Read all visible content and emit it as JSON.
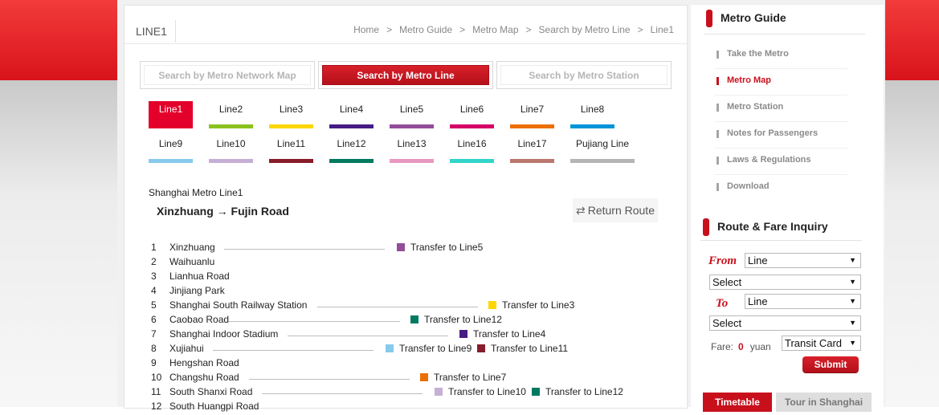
{
  "header": {
    "title": "LINE1",
    "breadcrumbs": [
      "Home",
      "Metro Guide",
      "Metro Map",
      "Search by Metro Line",
      "Line1"
    ],
    "separator": ">"
  },
  "search_tabs": [
    {
      "label": "Search by Metro Network Map",
      "active": false
    },
    {
      "label": "Search by Metro Line",
      "active": true
    },
    {
      "label": "Search by Metro Station",
      "active": false
    }
  ],
  "lines": [
    {
      "label": "Line1",
      "color": "#e3002b",
      "active": true
    },
    {
      "label": "Line2",
      "color": "#8cc220"
    },
    {
      "label": "Line3",
      "color": "#fcd600"
    },
    {
      "label": "Line4",
      "color": "#461d84"
    },
    {
      "label": "Line5",
      "color": "#944d9a"
    },
    {
      "label": "Line6",
      "color": "#d40068"
    },
    {
      "label": "Line7",
      "color": "#ed6f00"
    },
    {
      "label": "Line8",
      "color": "#0094d8"
    },
    {
      "label": "Line9",
      "color": "#87caed"
    },
    {
      "label": "Line10",
      "color": "#c6afd4"
    },
    {
      "label": "Line11",
      "color": "#871c2b"
    },
    {
      "label": "Line12",
      "color": "#007a60"
    },
    {
      "label": "Line13",
      "color": "#e999c0"
    },
    {
      "label": "Line16",
      "color": "#32d4cb"
    },
    {
      "label": "Line17",
      "color": "#bb786e"
    },
    {
      "label": "Pujiang Line",
      "color": "#b5b5b6"
    }
  ],
  "route": {
    "subtitle": "Shanghai Metro Line1",
    "title": "Xinzhuang → Fujin Road",
    "return_label": "Return Route",
    "return_icon": "swap-arrows-icon"
  },
  "stations": [
    {
      "num": "1",
      "name": "Xinzhuang",
      "transfers": [
        {
          "label": "Transfer to Line5",
          "color": "#944d9a"
        }
      ]
    },
    {
      "num": "2",
      "name": "Waihuanlu",
      "transfers": []
    },
    {
      "num": "3",
      "name": "Lianhua Road",
      "transfers": []
    },
    {
      "num": "4",
      "name": "Jinjiang Park",
      "transfers": []
    },
    {
      "num": "5",
      "name": "Shanghai South Railway Station",
      "transfers": [
        {
          "label": "Transfer to Line3",
          "color": "#fcd600"
        }
      ]
    },
    {
      "num": "6",
      "name": "Caobao Road",
      "transfers": [
        {
          "label": "Transfer to Line12",
          "color": "#007a60"
        }
      ]
    },
    {
      "num": "7",
      "name": "Shanghai Indoor Stadium",
      "transfers": [
        {
          "label": "Transfer to Line4",
          "color": "#461d84"
        }
      ]
    },
    {
      "num": "8",
      "name": "Xujiahui",
      "transfers": [
        {
          "label": "Transfer to Line9",
          "color": "#87caed"
        },
        {
          "label": "Transfer to Line11",
          "color": "#871c2b"
        }
      ]
    },
    {
      "num": "9",
      "name": "Hengshan Road",
      "transfers": []
    },
    {
      "num": "10",
      "name": "Changshu Road",
      "transfers": [
        {
          "label": "Transfer to Line7",
          "color": "#ed6f00"
        }
      ]
    },
    {
      "num": "11",
      "name": "South Shanxi Road",
      "transfers": [
        {
          "label": "Transfer to Line10",
          "color": "#c6afd4"
        },
        {
          "label": "Transfer to Line12",
          "color": "#007a60"
        }
      ]
    },
    {
      "num": "12",
      "name": "South Huangpi Road",
      "transfers": []
    }
  ],
  "sidebar": {
    "guide_title": "Metro Guide",
    "menu": [
      {
        "label": "Take the Metro",
        "active": false
      },
      {
        "label": "Metro Map",
        "active": true
      },
      {
        "label": "Metro Station",
        "active": false
      },
      {
        "label": "Notes for Passengers",
        "active": false
      },
      {
        "label": "Laws & Regulations",
        "active": false
      },
      {
        "label": "Download",
        "active": false
      }
    ],
    "fare_title": "Route & Fare Inquiry",
    "from_label": "From",
    "to_label": "To",
    "from_line": "Line",
    "from_station": "Select",
    "to_line": "Line",
    "to_station": "Select",
    "fare_label": "Fare:",
    "fare_value": "0",
    "fare_unit": "yuan",
    "card_type": "Transit Card",
    "submit_label": "Submit",
    "bottom_tabs": [
      "Timetable",
      "Tour in Shanghai"
    ]
  },
  "colors": {
    "accent": "#c8101d"
  }
}
